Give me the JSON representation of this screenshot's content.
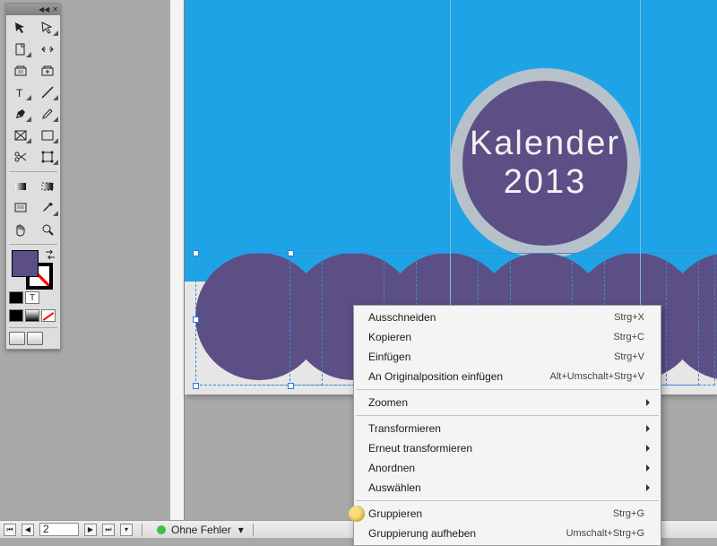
{
  "document": {
    "title_line1": "Kalender",
    "title_line2": "2013",
    "sky_color": "#1ea4e6",
    "circle_color": "#5c4f86"
  },
  "status": {
    "page": "2",
    "preflight": "Ohne Fehler"
  },
  "toolbox": {
    "collapse": "◀◀",
    "close": "✕"
  },
  "context_menu": {
    "items": [
      {
        "label": "Ausschneiden",
        "shortcut": "Strg+X"
      },
      {
        "label": "Kopieren",
        "shortcut": "Strg+C"
      },
      {
        "label": "Einfügen",
        "shortcut": "Strg+V"
      },
      {
        "label": "An Originalposition einfügen",
        "shortcut": "Alt+Umschalt+Strg+V"
      },
      {
        "sep": true
      },
      {
        "label": "Zoomen",
        "sub": true
      },
      {
        "sep": true
      },
      {
        "label": "Transformieren",
        "sub": true
      },
      {
        "label": "Erneut transformieren",
        "sub": true
      },
      {
        "label": "Anordnen",
        "sub": true
      },
      {
        "label": "Auswählen",
        "sub": true
      },
      {
        "sep": true
      },
      {
        "label": "Gruppieren",
        "shortcut": "Strg+G",
        "mark": true
      },
      {
        "label": "Gruppierung aufheben",
        "shortcut": "Umschalt+Strg+G"
      }
    ]
  },
  "tool_icons": [
    "selection",
    "direct-selection",
    "page",
    "gap",
    "content-collector",
    "content-placer",
    "type",
    "line",
    "pen",
    "pencil",
    "rectangle-frame",
    "rectangle",
    "scissors",
    "free-transform",
    "gradient-swatch",
    "gradient-feather",
    "note",
    "eyedropper",
    "hand",
    "zoom"
  ]
}
